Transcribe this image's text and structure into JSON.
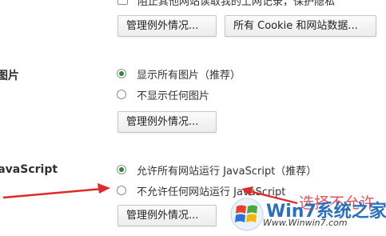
{
  "top": {
    "cut_text": "阻止其他网站读取我的上网记录，保护隐私",
    "buttons": [
      "管理例外情况...",
      "所有 Cookie 和网站数据..."
    ]
  },
  "images": {
    "label": "图片",
    "options": [
      "显示所有图片（推荐）",
      "不显示任何图片"
    ],
    "button": "管理例外情况..."
  },
  "javascript": {
    "label": "JavaScript",
    "options": [
      "允许所有网站运行 JavaScript（推荐）",
      "不允许任何网站运行 JavaScript"
    ],
    "button": "管理例外情况..."
  },
  "annotation": {
    "text": "选择不允许",
    "color": "#e0404a"
  },
  "watermark": {
    "text": "Win7系统之家",
    "url": "Www.Winwin7.com",
    "logo_icon": "windows-logo-icon"
  },
  "colors": {
    "radio_checked": "#2e8b2e",
    "arrow": "#e02a2a"
  }
}
